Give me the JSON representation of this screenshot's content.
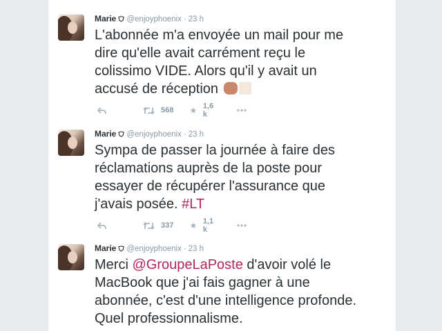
{
  "tweets": [
    {
      "name": "Marie",
      "handle": "@enjoyphoenix",
      "separator": "·",
      "time": "23 h",
      "text_line1": "L'abonnée m'a envoyée un mail pour me",
      "text_line2": "dire qu'elle avait carrément reçu le",
      "text_line3": "colissimo VIDE. Alors qu'il y avait un",
      "text_line4": "accusé de réception",
      "emojis": [
        "clapping-hands-emoji",
        "unsupported-emoji-box"
      ],
      "retweets": "568",
      "likes": "1,6 k"
    },
    {
      "name": "Marie",
      "handle": "@enjoyphoenix",
      "separator": "·",
      "time": "23 h",
      "text_line1": "Sympa de passer la journée à faire des",
      "text_line2": "réclamations auprès de la poste pour",
      "text_line3": "essayer de récupérer l'assurance que",
      "text_line4": "j'avais posée.",
      "hashtag": "#LT",
      "retweets": "337",
      "likes": "1,1 k"
    },
    {
      "name": "Marie",
      "handle": "@enjoyphoenix",
      "separator": "·",
      "time": "23 h",
      "text_line1_prefix": "Merci",
      "mention": "@GroupeLaPoste",
      "text_line1_suffix": "d'avoir volé le",
      "text_line2": "MacBook que j'ai fais gagner à une",
      "text_line3": "abonnée, c'est d'une intelligence profonde.",
      "text_line4": "Quel professionnalisme."
    }
  ],
  "colors": {
    "link": "#b1265c",
    "text": "#292f33",
    "muted": "#8899a6",
    "background": "#e9ecef"
  },
  "icons": [
    "reply-icon",
    "retweet-icon",
    "like-star-icon",
    "more-dots-icon",
    "verified-badge-icon"
  ]
}
